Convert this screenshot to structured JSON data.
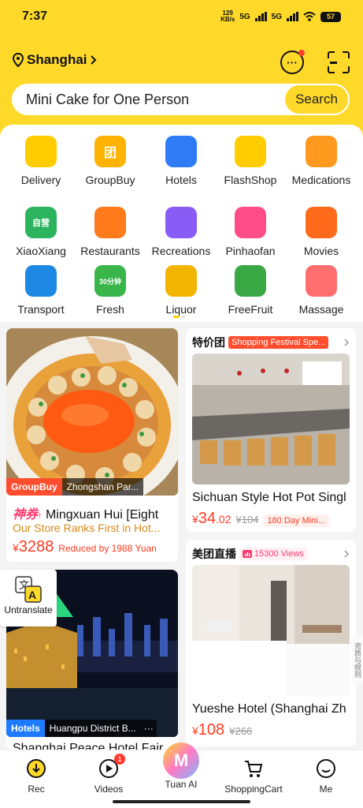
{
  "status": {
    "time": "7:37",
    "net_speed": "129",
    "net_unit": "KB/s",
    "signal1": "5G",
    "signal2": "5G",
    "battery": "57"
  },
  "header": {
    "location": "Shanghai",
    "search_value": "Mini Cake for One Person",
    "search_button": "Search"
  },
  "categories": [
    {
      "label": "Delivery",
      "icon": "kangaroo-icon",
      "color": "#ffcc00"
    },
    {
      "label": "GroupBuy",
      "icon": "groupbuy-icon",
      "color": "#ffb300",
      "glyph": "团"
    },
    {
      "label": "Hotels",
      "icon": "hotel-icon",
      "color": "#2f7bf5"
    },
    {
      "label": "FlashShop",
      "icon": "flash-bag-icon",
      "color": "#ffcc00"
    },
    {
      "label": "Medications",
      "icon": "medicine-box-icon",
      "color": "#ff9a1f"
    },
    {
      "label": "XiaoXiang",
      "icon": "elephant-icon",
      "color": "#2bb35d",
      "glyph": "自营"
    },
    {
      "label": "Restaurants",
      "icon": "utensils-icon",
      "color": "#ff7a1a"
    },
    {
      "label": "Recreations",
      "icon": "recreation-icon",
      "color": "#8a5cf6"
    },
    {
      "label": "Pinhaofan",
      "icon": "pinhaofan-icon",
      "color": "#ff4d8a"
    },
    {
      "label": "Movies",
      "icon": "cat-face-icon",
      "color": "#ff6b1a"
    },
    {
      "label": "Transport",
      "icon": "plane-icon",
      "color": "#1e88e5"
    },
    {
      "label": "Fresh",
      "icon": "fresh-icon",
      "color": "#39b54a",
      "glyph": "30分钟"
    },
    {
      "label": "Liquor",
      "icon": "liquor-icon",
      "color": "#f2b400"
    },
    {
      "label": "FreeFruit",
      "icon": "tree-icon",
      "color": "#3aa845"
    },
    {
      "label": "Massage",
      "icon": "massage-icon",
      "color": "#ff6f6f"
    }
  ],
  "feed_left": [
    {
      "tag": "GroupBuy",
      "location": "Zhongshan Par...",
      "badge": "神券",
      "title": "Mingxuan Hui [Eight",
      "subtitle": "Our Store Ranks First in Hot...",
      "yen": "¥",
      "price": "3288",
      "note": "Reduced by 1988 Yuan"
    },
    {
      "tag": "Hotels",
      "location": "Huangpu District B...",
      "title": "Shanghai Peace Hotel Fair"
    }
  ],
  "feed_right": [
    {
      "brand": "特价团",
      "label": "Shopping Festival Spe...",
      "title": "Sichuan Style Hot Pot Singl",
      "yen": "¥",
      "price": "34",
      "price_dec": ".02",
      "old": "¥104",
      "pill": "180 Day Mini..."
    },
    {
      "brand": "美团直播",
      "views": "15300 Views",
      "title": "Yueshe Hotel (Shanghai Zh",
      "yen": "¥",
      "price": "108",
      "old": "¥266"
    }
  ],
  "untranslate": {
    "label": "Untranslate"
  },
  "side_tab": {
    "label": "资质与规则"
  },
  "nav": {
    "items": [
      {
        "label": "Rec",
        "icon": "rec-icon"
      },
      {
        "label": "Videos",
        "icon": "video-play-icon",
        "badge": "1"
      },
      {
        "label": "Tuan AI",
        "icon": "tuan-ai-icon"
      },
      {
        "label": "ShoppingCart",
        "icon": "cart-icon"
      },
      {
        "label": "Me",
        "icon": "smile-face-icon"
      }
    ]
  }
}
